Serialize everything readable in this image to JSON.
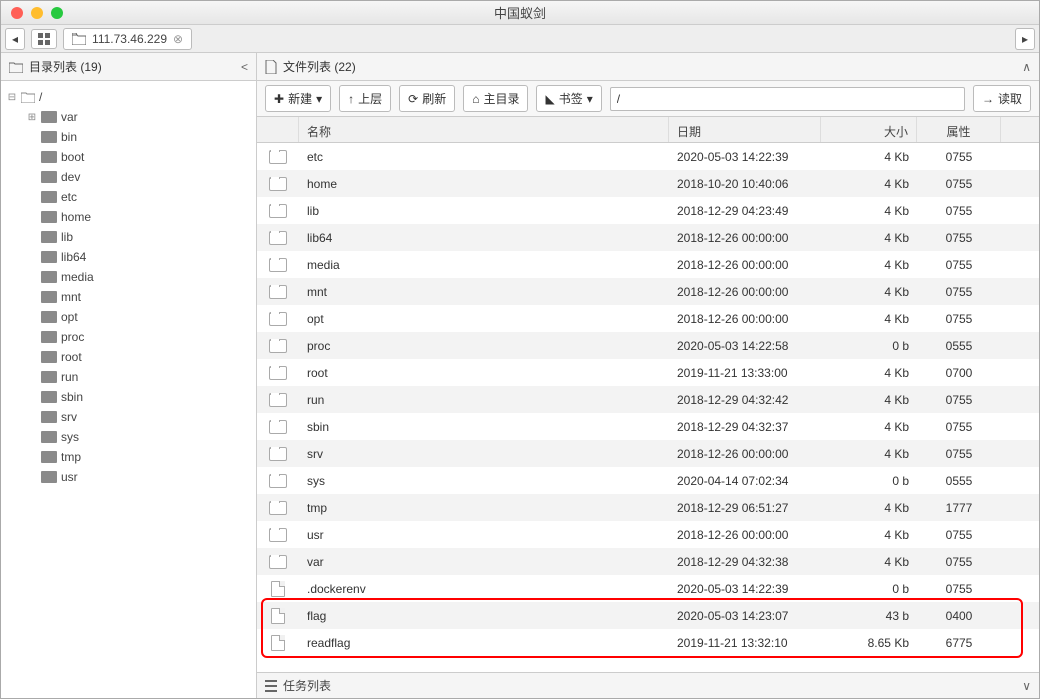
{
  "window_title": "中国蚁剑",
  "tabs": {
    "host": "111.73.46.229"
  },
  "sidebar": {
    "title_prefix": "目录列表",
    "count": 19,
    "root": "/",
    "items": [
      "var",
      "bin",
      "boot",
      "dev",
      "etc",
      "home",
      "lib",
      "lib64",
      "media",
      "mnt",
      "opt",
      "proc",
      "root",
      "run",
      "sbin",
      "srv",
      "sys",
      "tmp",
      "usr"
    ]
  },
  "filepane": {
    "title_prefix": "文件列表",
    "count": 22,
    "toolbar": {
      "new": "新建",
      "up": "上层",
      "refresh": "刷新",
      "home": "主目录",
      "bookmark": "书签",
      "path": "/",
      "read": "读取"
    },
    "columns": {
      "name": "名称",
      "date": "日期",
      "size": "大小",
      "attr": "属性"
    },
    "rows": [
      {
        "t": "d",
        "n": "etc",
        "d": "2020-05-03 14:22:39",
        "s": "4 Kb",
        "a": "0755"
      },
      {
        "t": "d",
        "n": "home",
        "d": "2018-10-20 10:40:06",
        "s": "4 Kb",
        "a": "0755"
      },
      {
        "t": "d",
        "n": "lib",
        "d": "2018-12-29 04:23:49",
        "s": "4 Kb",
        "a": "0755"
      },
      {
        "t": "d",
        "n": "lib64",
        "d": "2018-12-26 00:00:00",
        "s": "4 Kb",
        "a": "0755"
      },
      {
        "t": "d",
        "n": "media",
        "d": "2018-12-26 00:00:00",
        "s": "4 Kb",
        "a": "0755"
      },
      {
        "t": "d",
        "n": "mnt",
        "d": "2018-12-26 00:00:00",
        "s": "4 Kb",
        "a": "0755"
      },
      {
        "t": "d",
        "n": "opt",
        "d": "2018-12-26 00:00:00",
        "s": "4 Kb",
        "a": "0755"
      },
      {
        "t": "d",
        "n": "proc",
        "d": "2020-05-03 14:22:58",
        "s": "0 b",
        "a": "0555"
      },
      {
        "t": "d",
        "n": "root",
        "d": "2019-11-21 13:33:00",
        "s": "4 Kb",
        "a": "0700"
      },
      {
        "t": "d",
        "n": "run",
        "d": "2018-12-29 04:32:42",
        "s": "4 Kb",
        "a": "0755"
      },
      {
        "t": "d",
        "n": "sbin",
        "d": "2018-12-29 04:32:37",
        "s": "4 Kb",
        "a": "0755"
      },
      {
        "t": "d",
        "n": "srv",
        "d": "2018-12-26 00:00:00",
        "s": "4 Kb",
        "a": "0755"
      },
      {
        "t": "d",
        "n": "sys",
        "d": "2020-04-14 07:02:34",
        "s": "0 b",
        "a": "0555"
      },
      {
        "t": "d",
        "n": "tmp",
        "d": "2018-12-29 06:51:27",
        "s": "4 Kb",
        "a": "1777"
      },
      {
        "t": "d",
        "n": "usr",
        "d": "2018-12-26 00:00:00",
        "s": "4 Kb",
        "a": "0755"
      },
      {
        "t": "d",
        "n": "var",
        "d": "2018-12-29 04:32:38",
        "s": "4 Kb",
        "a": "0755"
      },
      {
        "t": "f",
        "n": ".dockerenv",
        "d": "2020-05-03 14:22:39",
        "s": "0 b",
        "a": "0755"
      },
      {
        "t": "f",
        "n": "flag",
        "d": "2020-05-03 14:23:07",
        "s": "43 b",
        "a": "0400"
      },
      {
        "t": "f",
        "n": "readflag",
        "d": "2019-11-21 13:32:10",
        "s": "8.65 Kb",
        "a": "6775"
      }
    ]
  },
  "taskbar": {
    "title": "任务列表"
  }
}
